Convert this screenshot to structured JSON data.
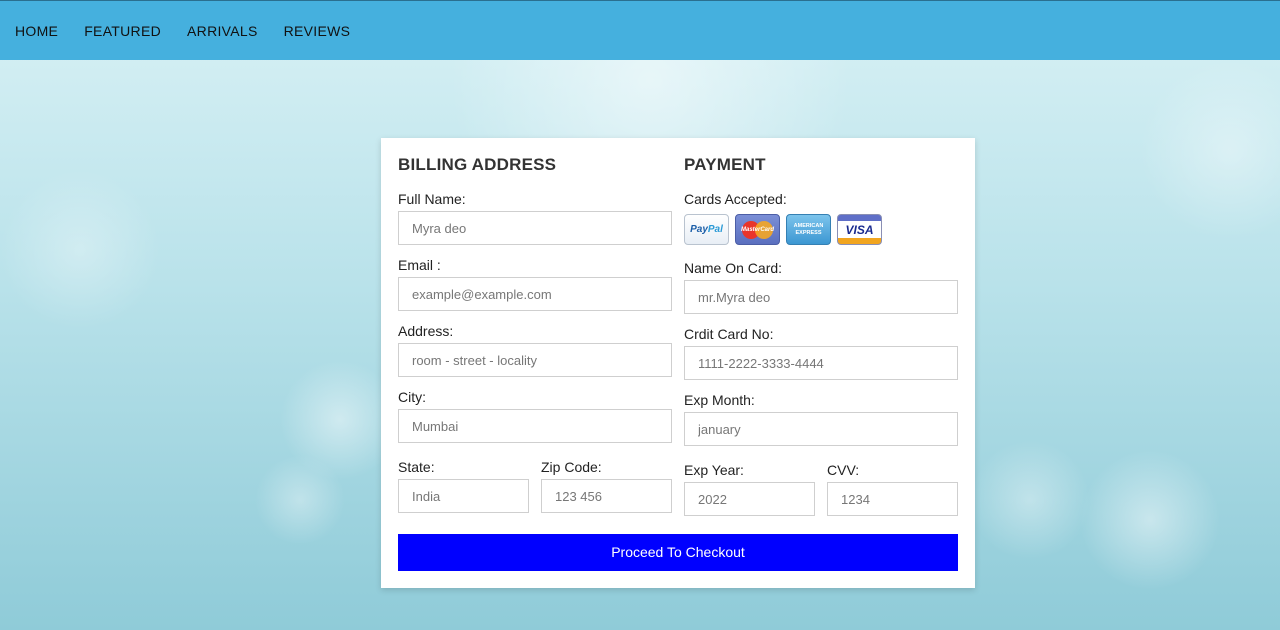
{
  "nav": {
    "items": [
      "HOME",
      "FEATURED",
      "ARRIVALS",
      "REVIEWS"
    ]
  },
  "billing": {
    "heading": "BILLING ADDRESS",
    "full_name": {
      "label": "Full Name:",
      "placeholder": "Myra deo"
    },
    "email": {
      "label": "Email :",
      "placeholder": "example@example.com"
    },
    "address": {
      "label": "Address:",
      "placeholder": "room - street - locality"
    },
    "city": {
      "label": "City:",
      "placeholder": "Mumbai"
    },
    "state": {
      "label": "State:",
      "placeholder": "India"
    },
    "zip": {
      "label": "Zip Code:",
      "placeholder": "123 456"
    }
  },
  "payment": {
    "heading": "PAYMENT",
    "cards_label": "Cards Accepted:",
    "cards": {
      "paypal_a": "Pay",
      "paypal_b": "Pal",
      "mastercard": "MasterCard",
      "amex_a": "AMERICAN",
      "amex_b": "EXPRESS",
      "visa": "VISA"
    },
    "name_on_card": {
      "label": "Name On Card:",
      "placeholder": "mr.Myra deo"
    },
    "card_no": {
      "label": "Crdit Card No:",
      "placeholder": "1111-2222-3333-4444"
    },
    "exp_month": {
      "label": "Exp Month:",
      "placeholder": "january"
    },
    "exp_year": {
      "label": "Exp Year:",
      "placeholder": "2022"
    },
    "cvv": {
      "label": "CVV:",
      "placeholder": "1234"
    }
  },
  "checkout_button": "Proceed To Checkout",
  "colors": {
    "navbar": "#45b0de",
    "button": "#0000ff"
  }
}
